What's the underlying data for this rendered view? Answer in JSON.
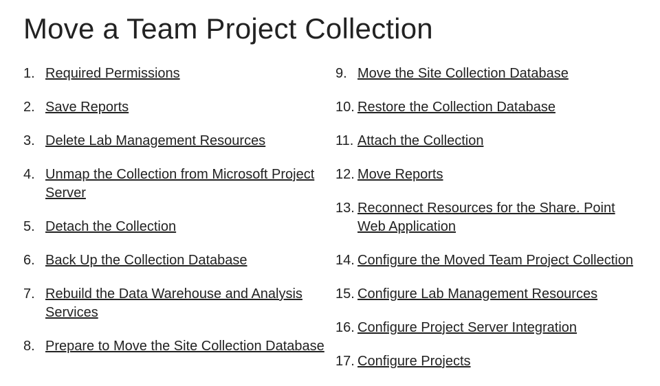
{
  "title": "Move a Team Project Collection",
  "left": [
    {
      "n": "1.",
      "t": "Required Permissions"
    },
    {
      "n": "2.",
      "t": "Save Reports"
    },
    {
      "n": "3.",
      "t": "Delete Lab Management Resources"
    },
    {
      "n": "4.",
      "t": "Unmap the Collection from Microsoft Project Server"
    },
    {
      "n": "5.",
      "t": "Detach the Collection"
    },
    {
      "n": "6.",
      "t": "Back Up the Collection Database"
    },
    {
      "n": "7.",
      "t": "Rebuild the Data Warehouse and Analysis Services"
    },
    {
      "n": "8.",
      "t": "Prepare to Move the Site Collection Database"
    }
  ],
  "right": [
    {
      "n": "9.",
      "t": "Move the Site Collection Database"
    },
    {
      "n": "10.",
      "t": "Restore the Collection Database"
    },
    {
      "n": "11.",
      "t": "Attach the Collection"
    },
    {
      "n": "12.",
      "t": "Move Reports"
    },
    {
      "n": "13.",
      "t": "Reconnect Resources for the Share. Point Web Application"
    },
    {
      "n": "14.",
      "t": "Configure the Moved Team Project Collection"
    },
    {
      "n": "15.",
      "t": "Configure Lab Management Resources"
    },
    {
      "n": "16.",
      "t": "Configure Project Server Integration"
    },
    {
      "n": "17.",
      "t": "Configure Projects"
    }
  ]
}
